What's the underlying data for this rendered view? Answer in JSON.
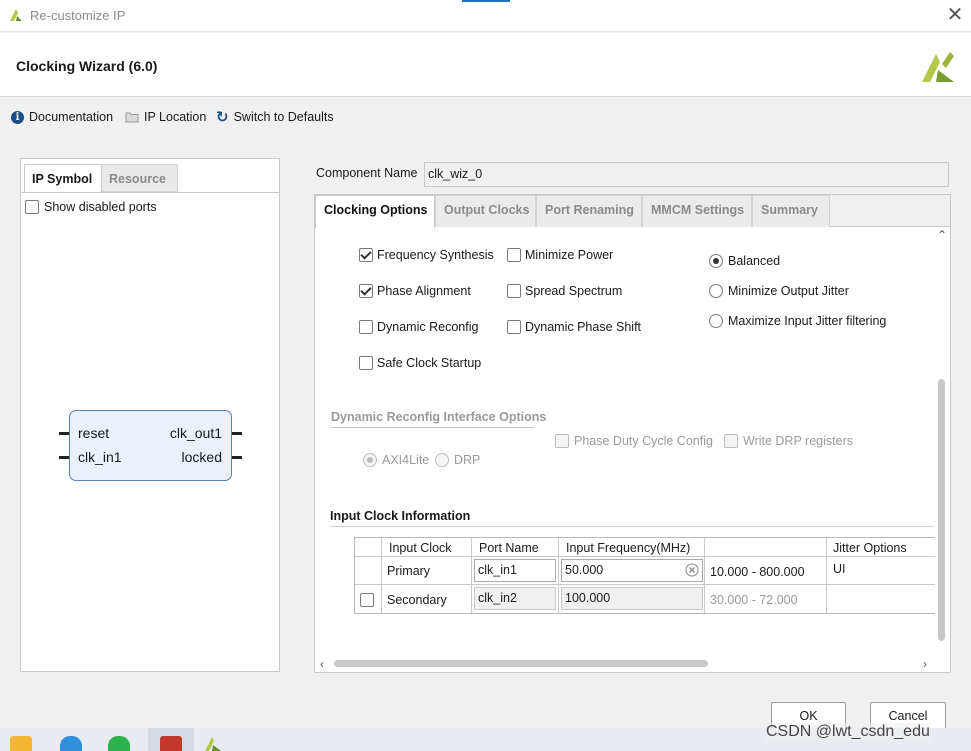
{
  "window": {
    "title": "Re-customize IP",
    "close_glyph": "✕"
  },
  "header": {
    "wizard_title": "Clocking Wizard (6.0)"
  },
  "toolbar": {
    "documentation": "Documentation",
    "ip_location": "IP Location",
    "switch_defaults": "Switch to Defaults",
    "info_glyph": "i",
    "refresh_glyph": "↻"
  },
  "left_panel": {
    "tabs": [
      "IP Symbol",
      "Resource"
    ],
    "show_disabled_ports": "Show disabled ports",
    "symbol": {
      "left_ports": [
        "reset",
        "clk_in1"
      ],
      "right_ports": [
        "clk_out1",
        "locked"
      ]
    }
  },
  "component": {
    "label": "Component Name",
    "value": "clk_wiz_0"
  },
  "tabs": [
    "Clocking Options",
    "Output Clocks",
    "Port Renaming",
    "MMCM Settings",
    "Summary"
  ],
  "options": {
    "frequency_synthesis": "Frequency Synthesis",
    "minimize_power": "Minimize Power",
    "phase_alignment": "Phase Alignment",
    "spread_spectrum": "Spread Spectrum",
    "dynamic_reconfig": "Dynamic Reconfig",
    "dynamic_phase_shift": "Dynamic Phase Shift",
    "safe_clock_startup": "Safe Clock Startup",
    "balanced": "Balanced",
    "minimize_output_jitter": "Minimize Output Jitter",
    "maximize_input_jitter": "Maximize Input Jitter filtering"
  },
  "dynamic_reconfig_section": {
    "title": "Dynamic Reconfig Interface Options",
    "phase_duty_cycle": "Phase Duty Cycle Config",
    "write_drp": "Write DRP registers",
    "axi4lite": "AXI4Lite",
    "drp": "DRP"
  },
  "input_clock": {
    "title": "Input Clock Information",
    "headers": [
      "Input Clock",
      "Port Name",
      "Input Frequency(MHz)",
      "",
      "Jitter Options"
    ],
    "rows": [
      {
        "clock": "Primary",
        "port": "clk_in1",
        "freq": "50.000",
        "range": "10.000 - 800.000",
        "jitter": "UI"
      },
      {
        "clock": "Secondary",
        "port": "clk_in2",
        "freq": "100.000",
        "range": "30.000 - 72.000",
        "jitter": ""
      }
    ]
  },
  "buttons": {
    "ok": "OK",
    "cancel": "Cancel"
  },
  "watermark": "CSDN @lwt_csdn_edu",
  "colors": {
    "accent_blue": "#1e73be",
    "xilinx_green": "#9bb43c",
    "symbol_fill": "#eaf1fb"
  }
}
